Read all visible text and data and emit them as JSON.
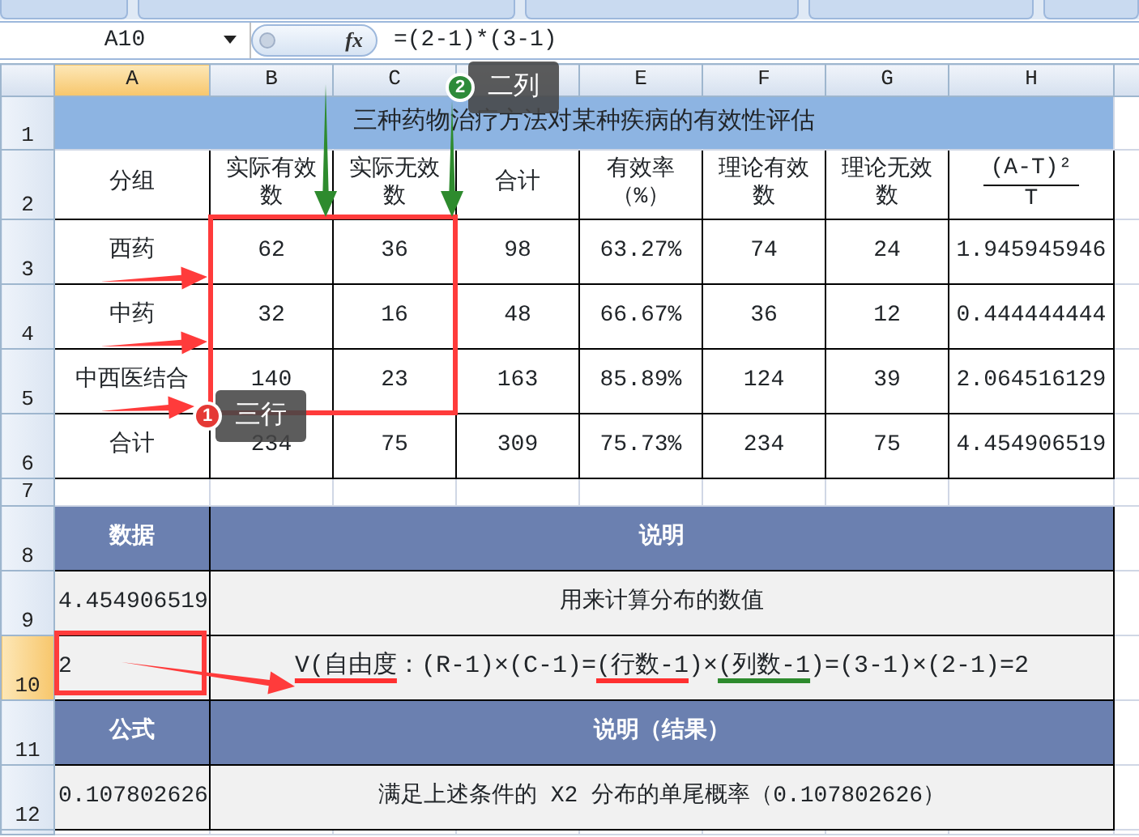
{
  "formula_bar": {
    "name_box": "A10",
    "fx": "fx",
    "formula": "=(2-1)*(3-1)"
  },
  "column_headers": [
    {
      "label": "A",
      "selected": true
    },
    {
      "label": "B",
      "selected": false
    },
    {
      "label": "C",
      "selected": false
    },
    {
      "selected": false
    },
    {
      "label": "E",
      "selected": false
    },
    {
      "label": "F",
      "selected": false
    },
    {
      "label": "G",
      "selected": false
    },
    {
      "label": "H",
      "selected": false
    }
  ],
  "row_headers": [
    {
      "label": "1",
      "selected": false
    },
    {
      "label": "2",
      "selected": false
    },
    {
      "label": "3",
      "selected": false
    },
    {
      "label": "4",
      "selected": false
    },
    {
      "label": "5",
      "selected": false
    },
    {
      "label": "6",
      "selected": false
    },
    {
      "label": "7",
      "selected": false
    },
    {
      "label": "8",
      "selected": false
    },
    {
      "label": "9",
      "selected": false
    },
    {
      "label": "10",
      "selected": true
    },
    {
      "label": "11",
      "selected": false
    },
    {
      "label": "12",
      "selected": false
    }
  ],
  "title": "三种药物治疗方法对某种疾病的有效性评估",
  "table": {
    "columns": [
      "分组",
      "实际有效数",
      "实际无效数",
      "合计",
      "有效率（%）",
      "理论有效数",
      "理论无效数"
    ],
    "fraction_column": {
      "numerator": "(A-T)²",
      "denominator": "T"
    },
    "rows": [
      [
        "西药",
        "62",
        "36",
        "98",
        "63.27%",
        "74",
        "24",
        "1.945945946"
      ],
      [
        "中药",
        "32",
        "16",
        "48",
        "66.67%",
        "36",
        "12",
        "0.444444444"
      ],
      [
        "中西医结合",
        "140",
        "23",
        "163",
        "85.89%",
        "124",
        "39",
        "2.064516129"
      ],
      [
        "合计",
        "234",
        "75",
        "309",
        "75.73%",
        "234",
        "75",
        "4.454906519"
      ]
    ]
  },
  "explain_table": {
    "rows": [
      {
        "kind": "header",
        "value": "数据",
        "description": "说明"
      },
      {
        "kind": "data",
        "value": "4.454906519",
        "description": "用来计算分布的数值"
      },
      {
        "kind": "data",
        "value": "2",
        "description_segments": [
          {
            "text": "V(自由度",
            "color": "#ff3030"
          },
          {
            "text": "：(R-1)×(C-1)="
          },
          {
            "text": "(行数-1",
            "color": "#ff3030"
          },
          {
            "text": ")×"
          },
          {
            "text": "(列数-1",
            "color": "#2e8b2e"
          },
          {
            "text": ")=(3-1)×(2-1)=2"
          }
        ]
      },
      {
        "kind": "header",
        "value": "公式",
        "description": "说明（结果）"
      },
      {
        "kind": "data",
        "value": "0.107802626",
        "description": "满足上述条件的 Χ2 分布的单尾概率（0.107802626）"
      }
    ]
  },
  "callouts": [
    {
      "number": "2",
      "label": "二列",
      "color": "#2e8b3a"
    },
    {
      "number": "1",
      "label": "三行",
      "color": "#e53935"
    }
  ]
}
